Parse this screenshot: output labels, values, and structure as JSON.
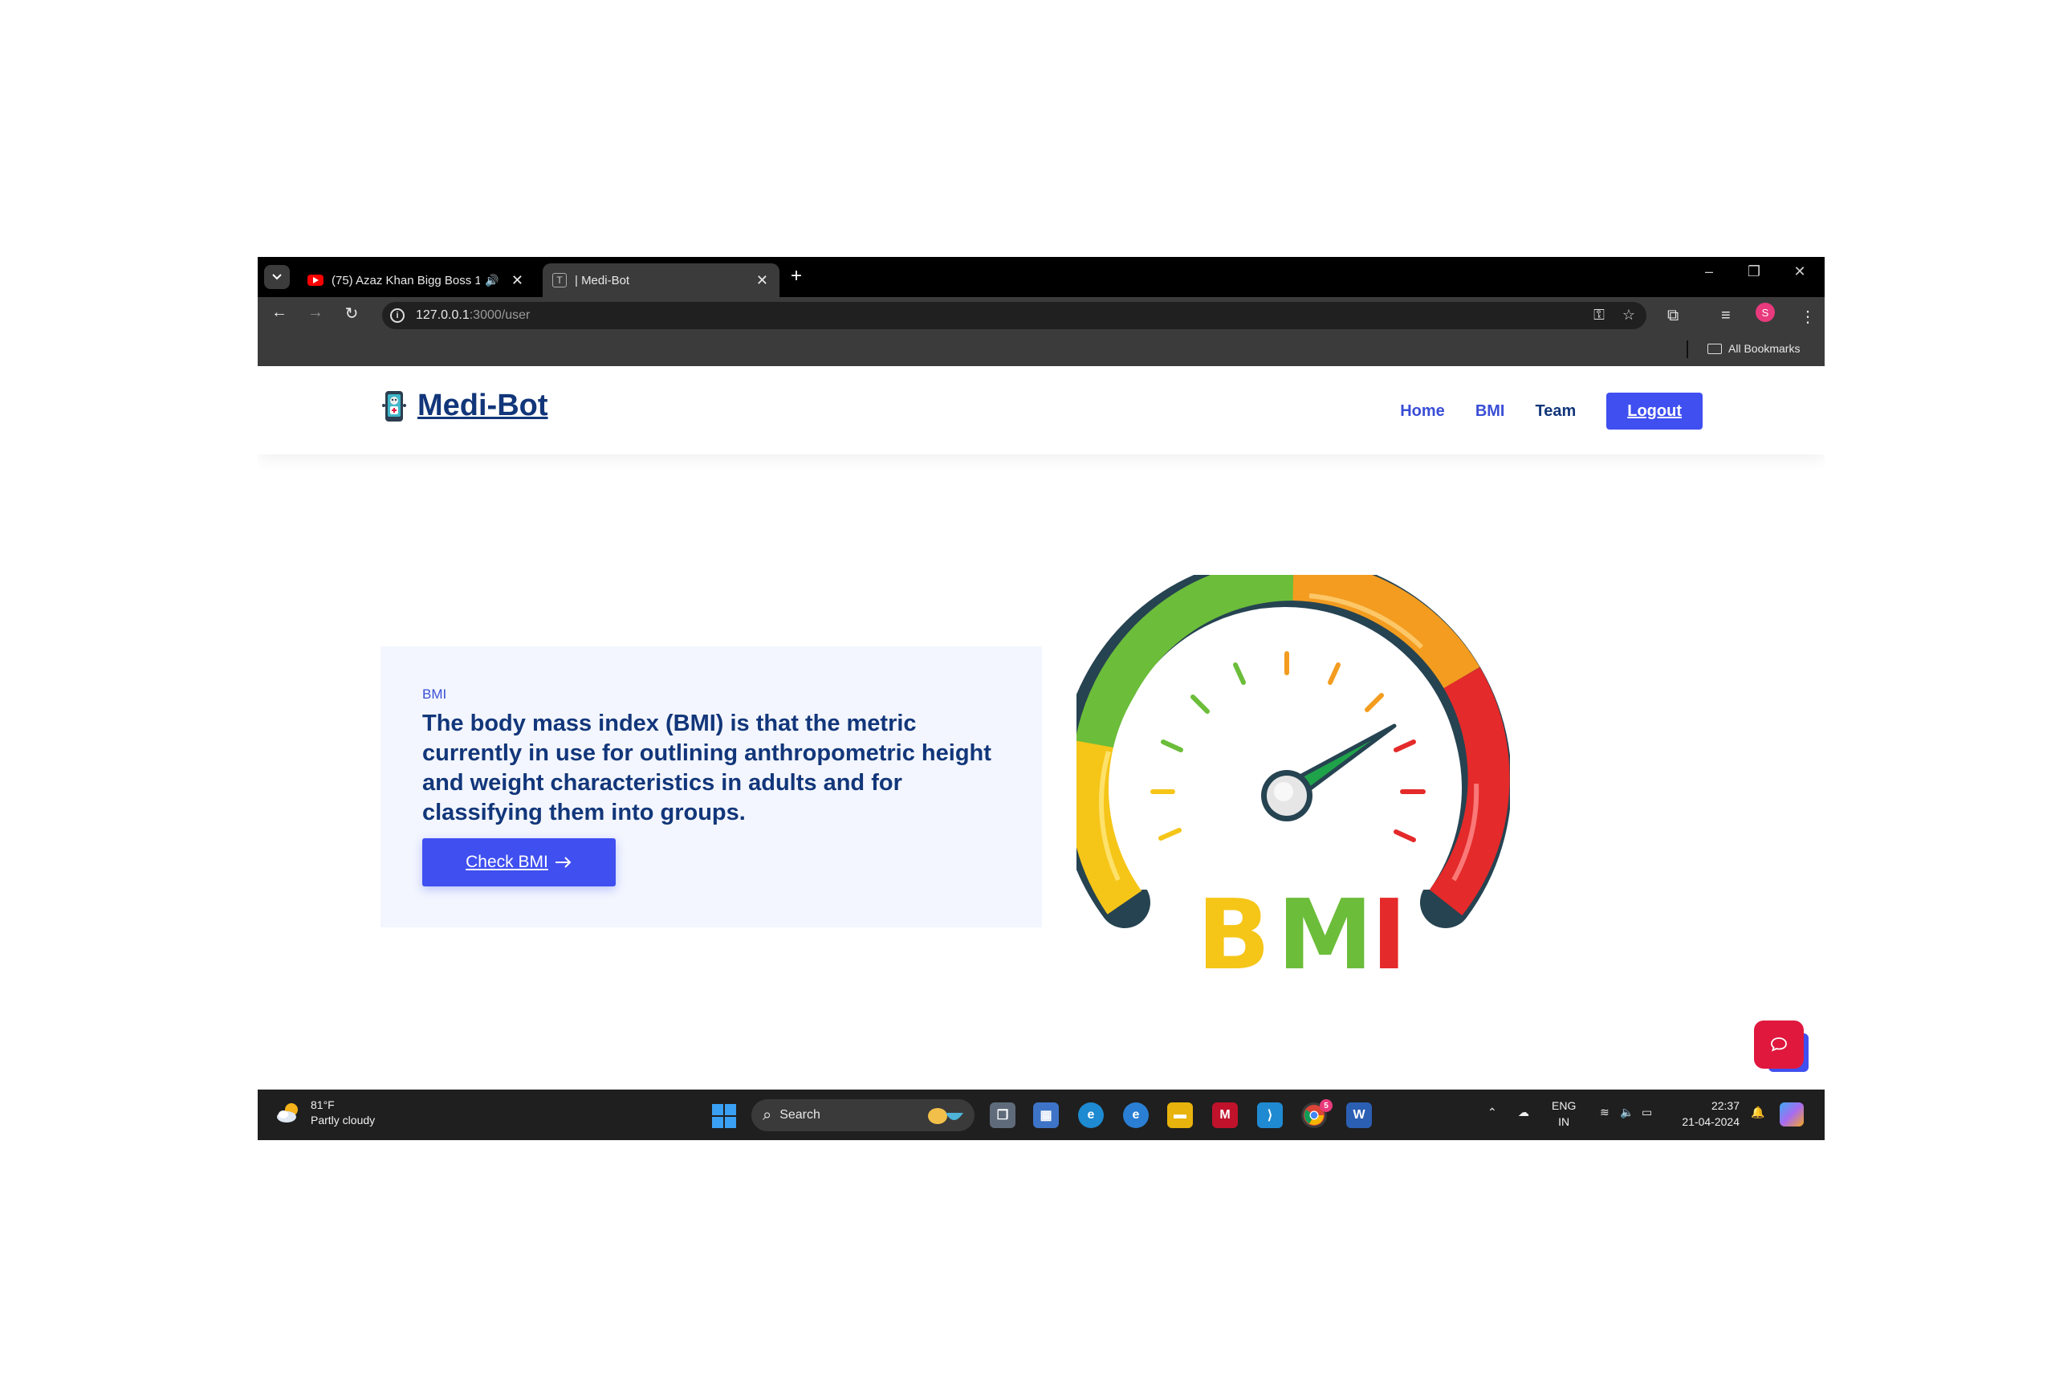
{
  "browser": {
    "tabs": [
      {
        "title": "(75) Azaz Khan Bigg Boss 1",
        "favicon": "youtube-icon",
        "audio": true
      },
      {
        "title": "| Medi-Bot",
        "favicon": "t-icon",
        "active": true
      }
    ],
    "url_host": "127.0.0.1",
    "url_rest": ":3000/user",
    "profile_initial": "S",
    "bookmarks_label": "All Bookmarks"
  },
  "site": {
    "brand": "Medi-Bot",
    "nav": {
      "home": "Home",
      "bmi": "BMI",
      "team": "Team",
      "logout": "Logout"
    },
    "hero": {
      "kicker": "BMI",
      "headline": "The body mass index (BMI) is that the metric currently in use for outlining anthropometric height and weight characteristics in adults and for classifying them into groups.",
      "cta": "Check BMI"
    },
    "gauge": {
      "label": "BMI",
      "colors": {
        "yellow": "#f5c518",
        "green": "#6cbd3a",
        "orange": "#f39c1f",
        "red": "#e42a2a",
        "outline": "#264351"
      },
      "needle_level_percent": 72
    },
    "accent": "#3f4ff0",
    "brand_color": "#12367a"
  },
  "taskbar": {
    "weather_temp": "81°F",
    "weather_desc": "Partly cloudy",
    "search_label": "Search",
    "lang_top": "ENG",
    "lang_bottom": "IN",
    "time": "22:37",
    "date": "21-04-2024",
    "chrome_badge": "5"
  }
}
